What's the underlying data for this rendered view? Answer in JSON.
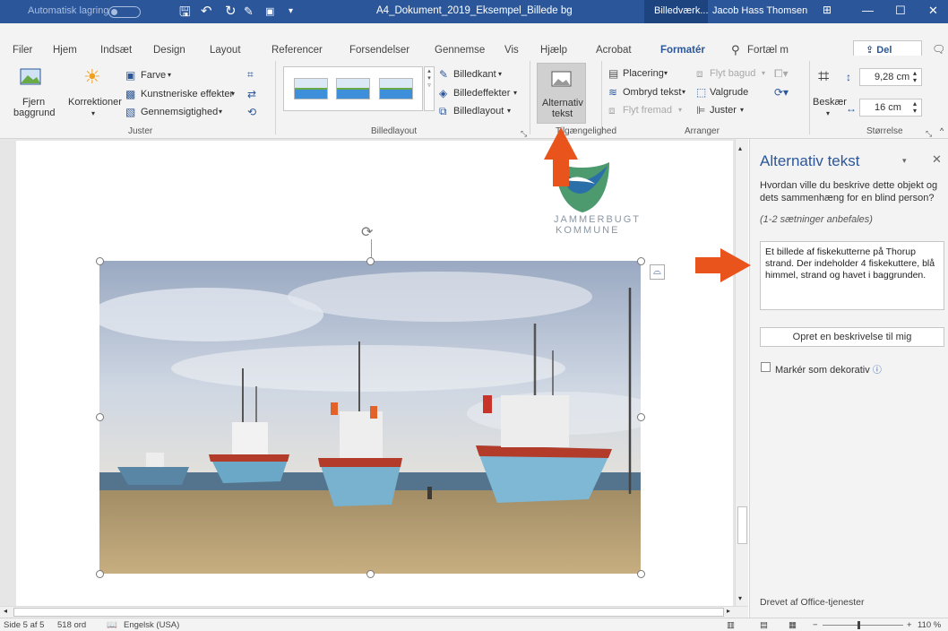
{
  "titlebar": {
    "autosave": "Automatisk lagring",
    "doc_title": "A4_Dokument_2019_Eksempel_Billede bg",
    "context_tab": "Billedværk...",
    "user": "Jacob Hass Thomsen",
    "minimize": "—",
    "maximize": "☐",
    "close": "✕"
  },
  "tabs": [
    "Filer",
    "Hjem",
    "Indsæt",
    "Design",
    "Layout",
    "Referencer",
    "Forsendelser",
    "Gennemse",
    "Vis",
    "Hjælp",
    "Acrobat",
    "Formatér"
  ],
  "tell_me": "Fortæl m",
  "share": "Del",
  "ribbon": {
    "remove_bg": "Fjern",
    "remove_bg2": "baggrund",
    "corrections": "Korrektioner",
    "color": "Farve",
    "artistic": "Kunstneriske effekter",
    "transparency": "Gennemsigtighed",
    "group_adjust": "Juster",
    "border": "Billedkant",
    "effects": "Billedeffekter",
    "layout": "Billedlayout",
    "group_styles": "Billedlayout",
    "alt_text_1": "Alternativ",
    "alt_text_2": "tekst",
    "group_access": "Tilgængelighed",
    "position": "Placering",
    "wrap": "Ombryd tekst",
    "forward": "Flyt fremad",
    "backward": "Flyt bagud",
    "selection": "Valgrude",
    "align": "Juster",
    "group_arrange": "Arranger",
    "crop": "Beskær",
    "height": "9,28 cm",
    "width": "16 cm",
    "group_size": "Størrelse"
  },
  "logo": {
    "line1": "JAMMERBUGT",
    "line2": "KOMMUNE"
  },
  "pane": {
    "title": "Alternativ tekst",
    "question": "Hvordan ville du beskrive dette objekt og dets sammenhæng for en blind person?",
    "hint": "(1-2 sætninger anbefales)",
    "alt_text": "Et billede af fiskekutterne på Thorup strand. Der indeholder 4 fiskekuttere, blå himmel, strand og havet i baggrunden.",
    "generate_button": "Opret en beskrivelse til mig",
    "decorative_label": "Markér som dekorativ",
    "footer": "Drevet af Office-tjenester"
  },
  "status": {
    "page": "Side 5 af 5",
    "words": "518 ord",
    "language": "Engelsk (USA)",
    "zoom": "110 %"
  },
  "colors": {
    "accent": "#2b579a",
    "annotation_arrow": "#e8541c"
  }
}
